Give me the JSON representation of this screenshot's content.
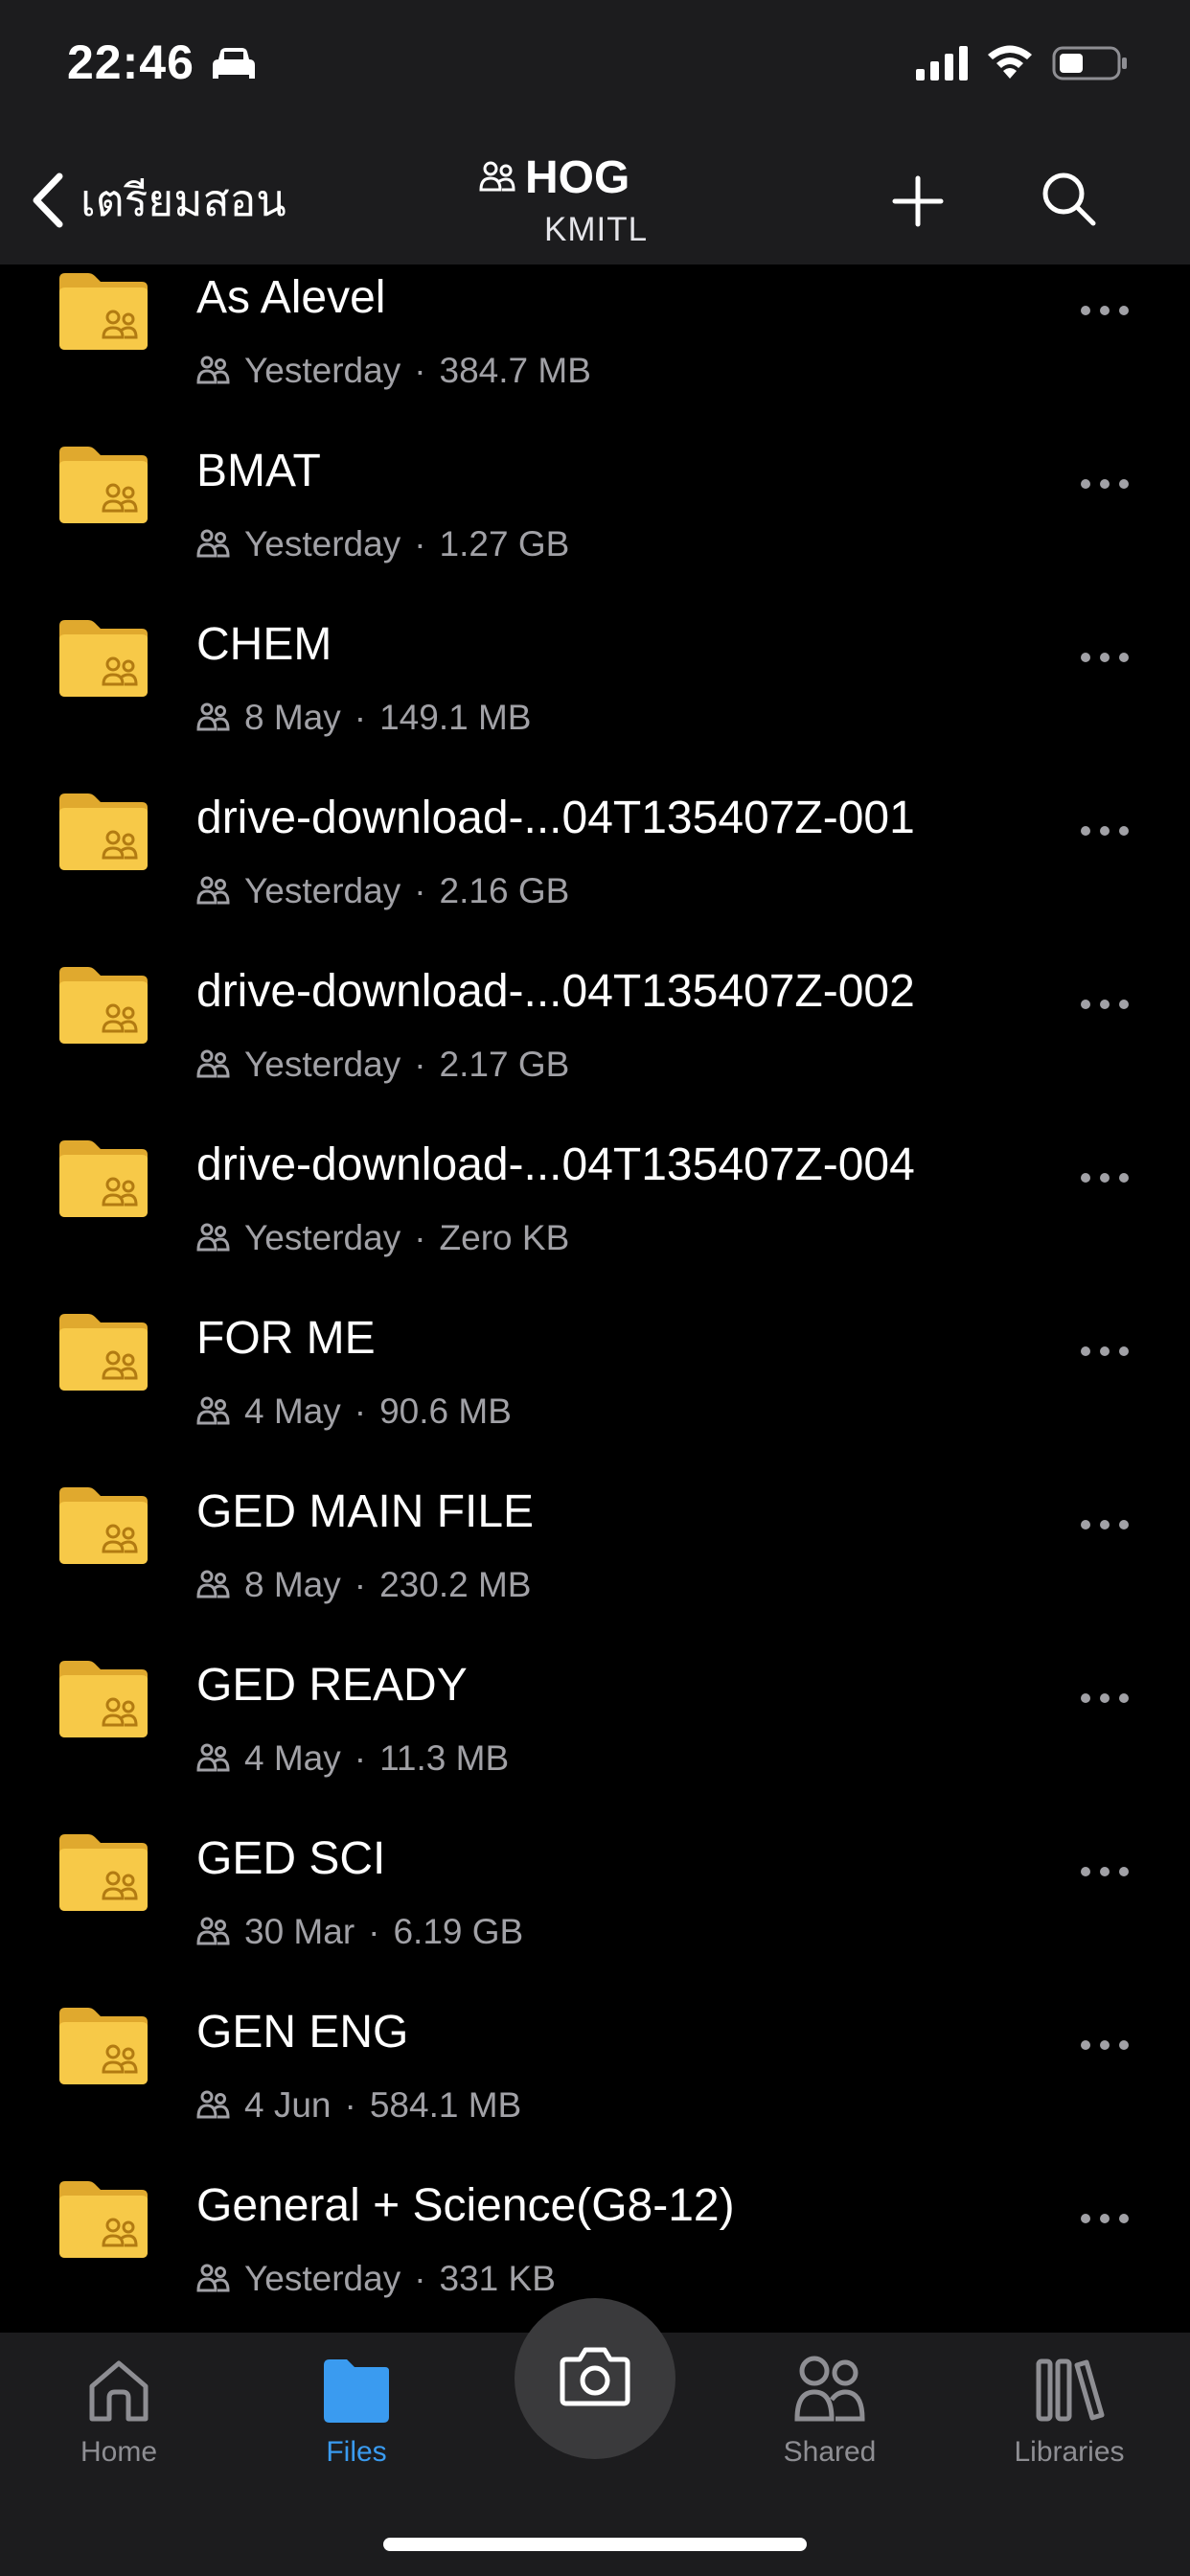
{
  "status": {
    "time": "22:46"
  },
  "header": {
    "back_label": "เตรียมสอน",
    "title": "HOG",
    "subtitle": "KMITL"
  },
  "files": [
    {
      "name": "As Alevel",
      "date": "Yesterday",
      "size": "384.7 MB"
    },
    {
      "name": "BMAT",
      "date": "Yesterday",
      "size": "1.27 GB"
    },
    {
      "name": "CHEM",
      "date": "8 May",
      "size": "149.1 MB"
    },
    {
      "name": "drive-download-...04T135407Z-001",
      "date": "Yesterday",
      "size": "2.16 GB"
    },
    {
      "name": "drive-download-...04T135407Z-002",
      "date": "Yesterday",
      "size": "2.17 GB"
    },
    {
      "name": "drive-download-...04T135407Z-004",
      "date": "Yesterday",
      "size": "Zero KB"
    },
    {
      "name": "FOR ME",
      "date": "4 May",
      "size": "90.6 MB"
    },
    {
      "name": "GED MAIN FILE",
      "date": "8 May",
      "size": "230.2 MB"
    },
    {
      "name": "GED READY",
      "date": "4 May",
      "size": "11.3 MB"
    },
    {
      "name": "GED SCI",
      "date": "30 Mar",
      "size": "6.19 GB"
    },
    {
      "name": "GEN ENG",
      "date": "4 Jun",
      "size": "584.1 MB"
    },
    {
      "name": "General + Science(G8-12)",
      "date": "Yesterday",
      "size": "331 KB"
    }
  ],
  "meta_separator": "·",
  "tabs": {
    "home": "Home",
    "files": "Files",
    "shared": "Shared",
    "libraries": "Libraries"
  },
  "colors": {
    "accent": "#3a9bf0",
    "folder": "#f7c948",
    "background": "#000000",
    "bar": "#1c1c1e"
  }
}
